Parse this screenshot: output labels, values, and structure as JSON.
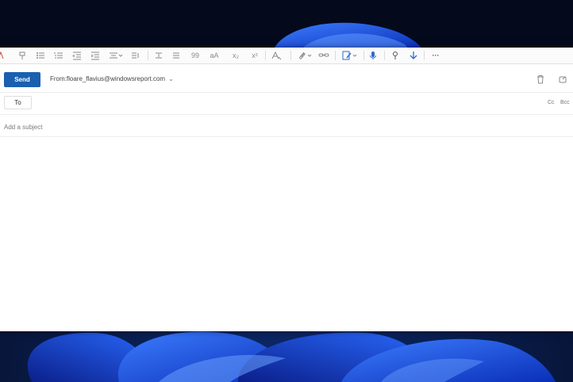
{
  "compose": {
    "send_label": "Send",
    "from_label": "From:",
    "from_address": "floare_flavius@windowsreport.com",
    "to_label": "To",
    "cc_label": "Cc",
    "bcc_label": "Bcc",
    "subject_placeholder": "Add a subject"
  },
  "toolbar": {
    "icons": [
      "format-painter-icon",
      "bullets-icon",
      "numbering-icon",
      "decrease-indent-icon",
      "increase-indent-icon",
      "align-icon",
      "indent-icon",
      "line-spacing-icon",
      "quote-icon",
      "font-size-icon",
      "subscript-icon",
      "superscript-icon",
      "clear-formatting-icon",
      "attach-icon",
      "link-icon",
      "editor-icon",
      "dictate-icon",
      "sensitivity-icon",
      "download-icon",
      "more-options-icon"
    ],
    "quote_glyph": "99",
    "font_size_glyph": "aA",
    "subscript_glyph": "x₂",
    "superscript_glyph": "x²",
    "more_glyph": "···"
  },
  "colors": {
    "accent": "#1b5fb0",
    "toolbar_accent": "#2a6bd1",
    "wallpaper_bg": "#07102a",
    "bloom": "#1a5cff"
  }
}
